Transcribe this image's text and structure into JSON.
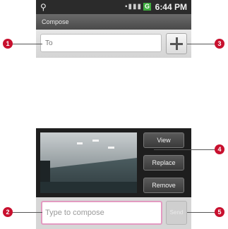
{
  "status_bar": {
    "time": "6:44 PM",
    "network_badge": "G",
    "signal_glyphs": "▪▮▮▮",
    "usb_glyph": "⚲"
  },
  "title_bar": {
    "title": "Compose"
  },
  "recipient": {
    "placeholder": "To",
    "add_button_icon": "plus-icon"
  },
  "attachment": {
    "buttons": [
      "View",
      "Replace",
      "Remove"
    ]
  },
  "composer": {
    "placeholder": "Type to compose",
    "send_label": "Send"
  },
  "callouts": [
    "1",
    "2",
    "3",
    "4",
    "5"
  ],
  "colors": {
    "callout": "#c8102e",
    "compose_focus_border": "#e39ac1",
    "title_bar": "#555555"
  }
}
